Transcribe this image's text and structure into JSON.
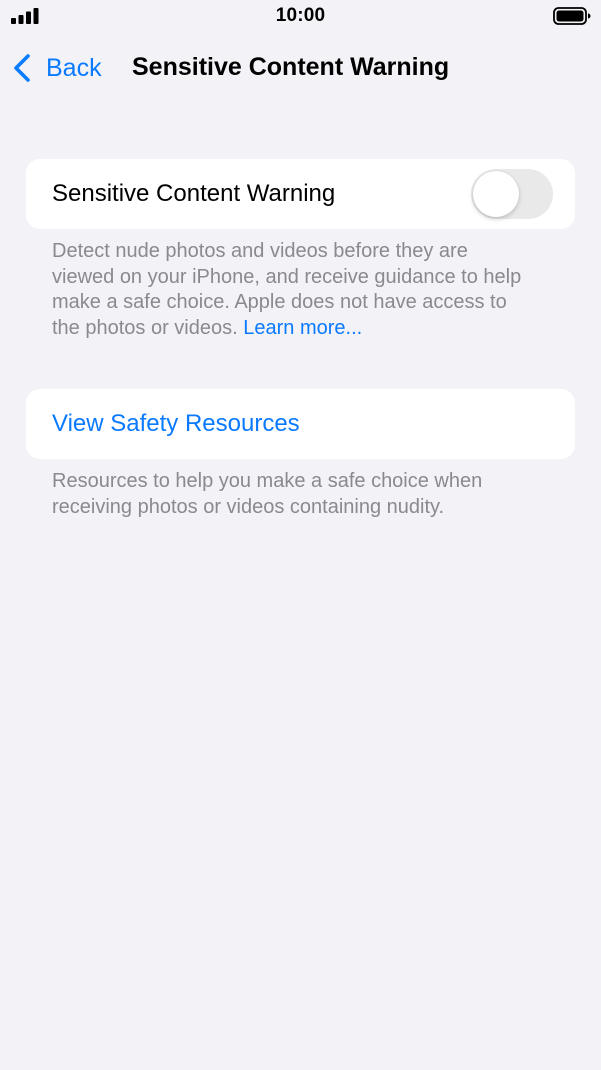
{
  "status_bar": {
    "time": "10:00",
    "icons": [
      "signal-icon",
      "battery-icon"
    ]
  },
  "nav": {
    "back_label": "Back",
    "back_icon": "chevron-left-icon",
    "title": "Sensitive Content Warning"
  },
  "sensitive_toggle": {
    "label": "Sensitive Content Warning",
    "enabled": false
  },
  "toggle_footer": {
    "text": "Detect nude photos and videos before they are viewed on your iPhone, and receive guidance to help make a safe choice. Apple does not have access to the photos or videos. ",
    "link": "Learn more..."
  },
  "resources": {
    "label": "View Safety Resources",
    "footer": "Resources to help you make a safe choice when receiving photos or videos containing nudity."
  },
  "colors": {
    "accent": "#0a7aff",
    "background": "#f2f2f7",
    "secondary_text": "#8a8a8e",
    "toggle_off": "#e9e9ea"
  }
}
